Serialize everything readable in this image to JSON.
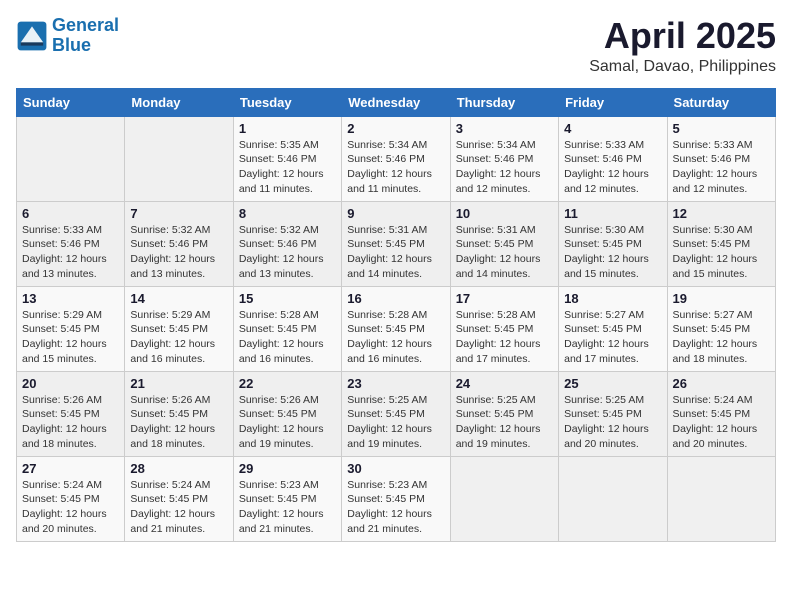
{
  "header": {
    "logo_line1": "General",
    "logo_line2": "Blue",
    "month_title": "April 2025",
    "location": "Samal, Davao, Philippines"
  },
  "weekdays": [
    "Sunday",
    "Monday",
    "Tuesday",
    "Wednesday",
    "Thursday",
    "Friday",
    "Saturday"
  ],
  "weeks": [
    [
      {
        "day": "",
        "content": ""
      },
      {
        "day": "",
        "content": ""
      },
      {
        "day": "1",
        "content": "Sunrise: 5:35 AM\nSunset: 5:46 PM\nDaylight: 12 hours\nand 11 minutes."
      },
      {
        "day": "2",
        "content": "Sunrise: 5:34 AM\nSunset: 5:46 PM\nDaylight: 12 hours\nand 11 minutes."
      },
      {
        "day": "3",
        "content": "Sunrise: 5:34 AM\nSunset: 5:46 PM\nDaylight: 12 hours\nand 12 minutes."
      },
      {
        "day": "4",
        "content": "Sunrise: 5:33 AM\nSunset: 5:46 PM\nDaylight: 12 hours\nand 12 minutes."
      },
      {
        "day": "5",
        "content": "Sunrise: 5:33 AM\nSunset: 5:46 PM\nDaylight: 12 hours\nand 12 minutes."
      }
    ],
    [
      {
        "day": "6",
        "content": "Sunrise: 5:33 AM\nSunset: 5:46 PM\nDaylight: 12 hours\nand 13 minutes."
      },
      {
        "day": "7",
        "content": "Sunrise: 5:32 AM\nSunset: 5:46 PM\nDaylight: 12 hours\nand 13 minutes."
      },
      {
        "day": "8",
        "content": "Sunrise: 5:32 AM\nSunset: 5:46 PM\nDaylight: 12 hours\nand 13 minutes."
      },
      {
        "day": "9",
        "content": "Sunrise: 5:31 AM\nSunset: 5:45 PM\nDaylight: 12 hours\nand 14 minutes."
      },
      {
        "day": "10",
        "content": "Sunrise: 5:31 AM\nSunset: 5:45 PM\nDaylight: 12 hours\nand 14 minutes."
      },
      {
        "day": "11",
        "content": "Sunrise: 5:30 AM\nSunset: 5:45 PM\nDaylight: 12 hours\nand 15 minutes."
      },
      {
        "day": "12",
        "content": "Sunrise: 5:30 AM\nSunset: 5:45 PM\nDaylight: 12 hours\nand 15 minutes."
      }
    ],
    [
      {
        "day": "13",
        "content": "Sunrise: 5:29 AM\nSunset: 5:45 PM\nDaylight: 12 hours\nand 15 minutes."
      },
      {
        "day": "14",
        "content": "Sunrise: 5:29 AM\nSunset: 5:45 PM\nDaylight: 12 hours\nand 16 minutes."
      },
      {
        "day": "15",
        "content": "Sunrise: 5:28 AM\nSunset: 5:45 PM\nDaylight: 12 hours\nand 16 minutes."
      },
      {
        "day": "16",
        "content": "Sunrise: 5:28 AM\nSunset: 5:45 PM\nDaylight: 12 hours\nand 16 minutes."
      },
      {
        "day": "17",
        "content": "Sunrise: 5:28 AM\nSunset: 5:45 PM\nDaylight: 12 hours\nand 17 minutes."
      },
      {
        "day": "18",
        "content": "Sunrise: 5:27 AM\nSunset: 5:45 PM\nDaylight: 12 hours\nand 17 minutes."
      },
      {
        "day": "19",
        "content": "Sunrise: 5:27 AM\nSunset: 5:45 PM\nDaylight: 12 hours\nand 18 minutes."
      }
    ],
    [
      {
        "day": "20",
        "content": "Sunrise: 5:26 AM\nSunset: 5:45 PM\nDaylight: 12 hours\nand 18 minutes."
      },
      {
        "day": "21",
        "content": "Sunrise: 5:26 AM\nSunset: 5:45 PM\nDaylight: 12 hours\nand 18 minutes."
      },
      {
        "day": "22",
        "content": "Sunrise: 5:26 AM\nSunset: 5:45 PM\nDaylight: 12 hours\nand 19 minutes."
      },
      {
        "day": "23",
        "content": "Sunrise: 5:25 AM\nSunset: 5:45 PM\nDaylight: 12 hours\nand 19 minutes."
      },
      {
        "day": "24",
        "content": "Sunrise: 5:25 AM\nSunset: 5:45 PM\nDaylight: 12 hours\nand 19 minutes."
      },
      {
        "day": "25",
        "content": "Sunrise: 5:25 AM\nSunset: 5:45 PM\nDaylight: 12 hours\nand 20 minutes."
      },
      {
        "day": "26",
        "content": "Sunrise: 5:24 AM\nSunset: 5:45 PM\nDaylight: 12 hours\nand 20 minutes."
      }
    ],
    [
      {
        "day": "27",
        "content": "Sunrise: 5:24 AM\nSunset: 5:45 PM\nDaylight: 12 hours\nand 20 minutes."
      },
      {
        "day": "28",
        "content": "Sunrise: 5:24 AM\nSunset: 5:45 PM\nDaylight: 12 hours\nand 21 minutes."
      },
      {
        "day": "29",
        "content": "Sunrise: 5:23 AM\nSunset: 5:45 PM\nDaylight: 12 hours\nand 21 minutes."
      },
      {
        "day": "30",
        "content": "Sunrise: 5:23 AM\nSunset: 5:45 PM\nDaylight: 12 hours\nand 21 minutes."
      },
      {
        "day": "",
        "content": ""
      },
      {
        "day": "",
        "content": ""
      },
      {
        "day": "",
        "content": ""
      }
    ]
  ]
}
